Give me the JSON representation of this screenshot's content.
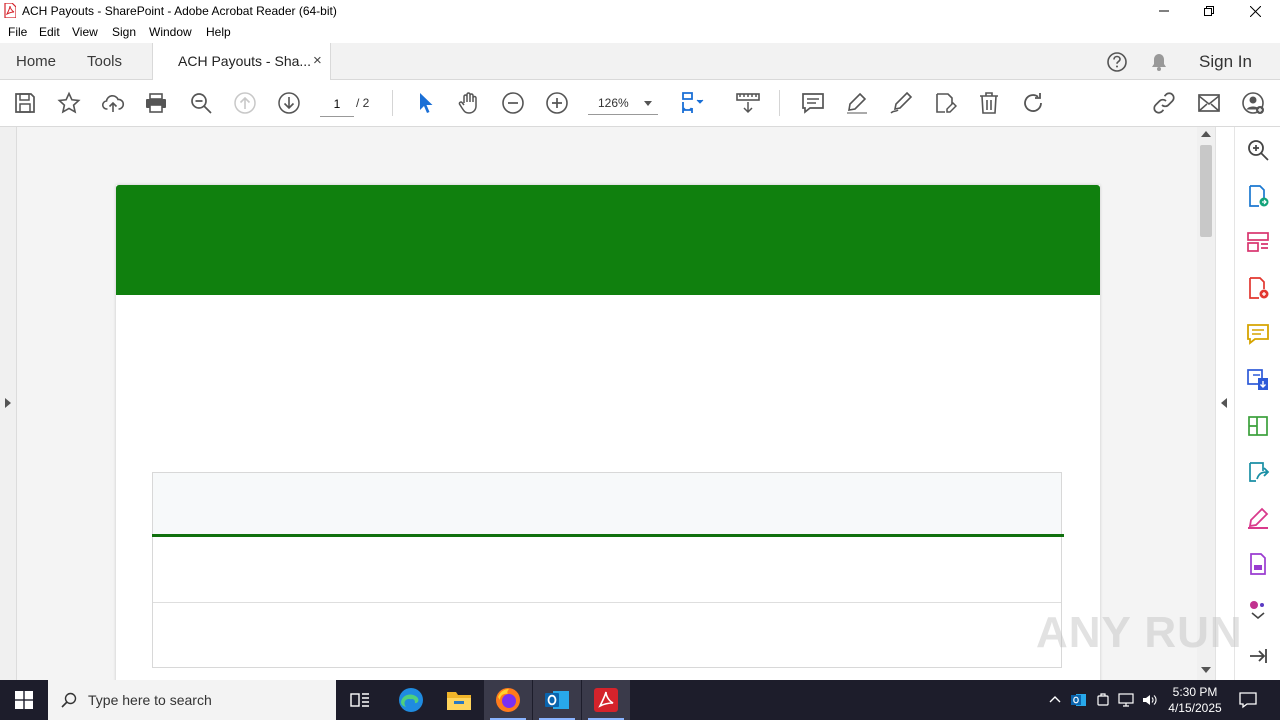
{
  "window": {
    "title": "ACH Payouts - SharePoint - Adobe Acrobat Reader (64-bit)",
    "controls": [
      "minimize",
      "restore",
      "close"
    ]
  },
  "menu": [
    "File",
    "Edit",
    "View",
    "Sign",
    "Window",
    "Help"
  ],
  "tabs": {
    "home": "Home",
    "tools": "Tools",
    "document": "ACH Payouts - Sha...",
    "close_symbol": "×",
    "sign_in": "Sign In"
  },
  "toolbar": {
    "current_page": "1",
    "total_pages": "/ 2",
    "zoom": "126%",
    "icons": [
      "save-icon",
      "star-icon",
      "upload-icon",
      "print-icon",
      "search-zoom-icon",
      "page-up-icon",
      "page-down-icon",
      "select-cursor-icon",
      "hand-icon",
      "zoom-out-icon",
      "zoom-in-icon",
      "fit-page-icon",
      "scroll-mode-icon",
      "comment-icon",
      "highlight-icon",
      "draw-icon",
      "fill-sign-icon",
      "delete-icon",
      "rotate-icon",
      "link-icon",
      "email-icon",
      "share-user-icon"
    ]
  },
  "document": {
    "banner_color": "#10800e",
    "table_rule_color": "#10700e"
  },
  "right_panel": {
    "icons": [
      "zoom-search-icon",
      "export-pdf-icon",
      "organize-pages-icon",
      "create-pdf-icon",
      "comment-icon",
      "combine-files-icon",
      "edit-pdf-icon",
      "export-convert-icon",
      "fill-sign-icon",
      "protect-icon",
      "more-tools-icon",
      "expand-icon"
    ]
  },
  "watermark": "ANY RUN",
  "taskbar": {
    "search_placeholder": "Type here to search",
    "time": "5:30 PM",
    "date": "4/15/2025",
    "apps": [
      "task-view",
      "edge",
      "file-explorer",
      "firefox",
      "outlook",
      "acrobat"
    ]
  }
}
